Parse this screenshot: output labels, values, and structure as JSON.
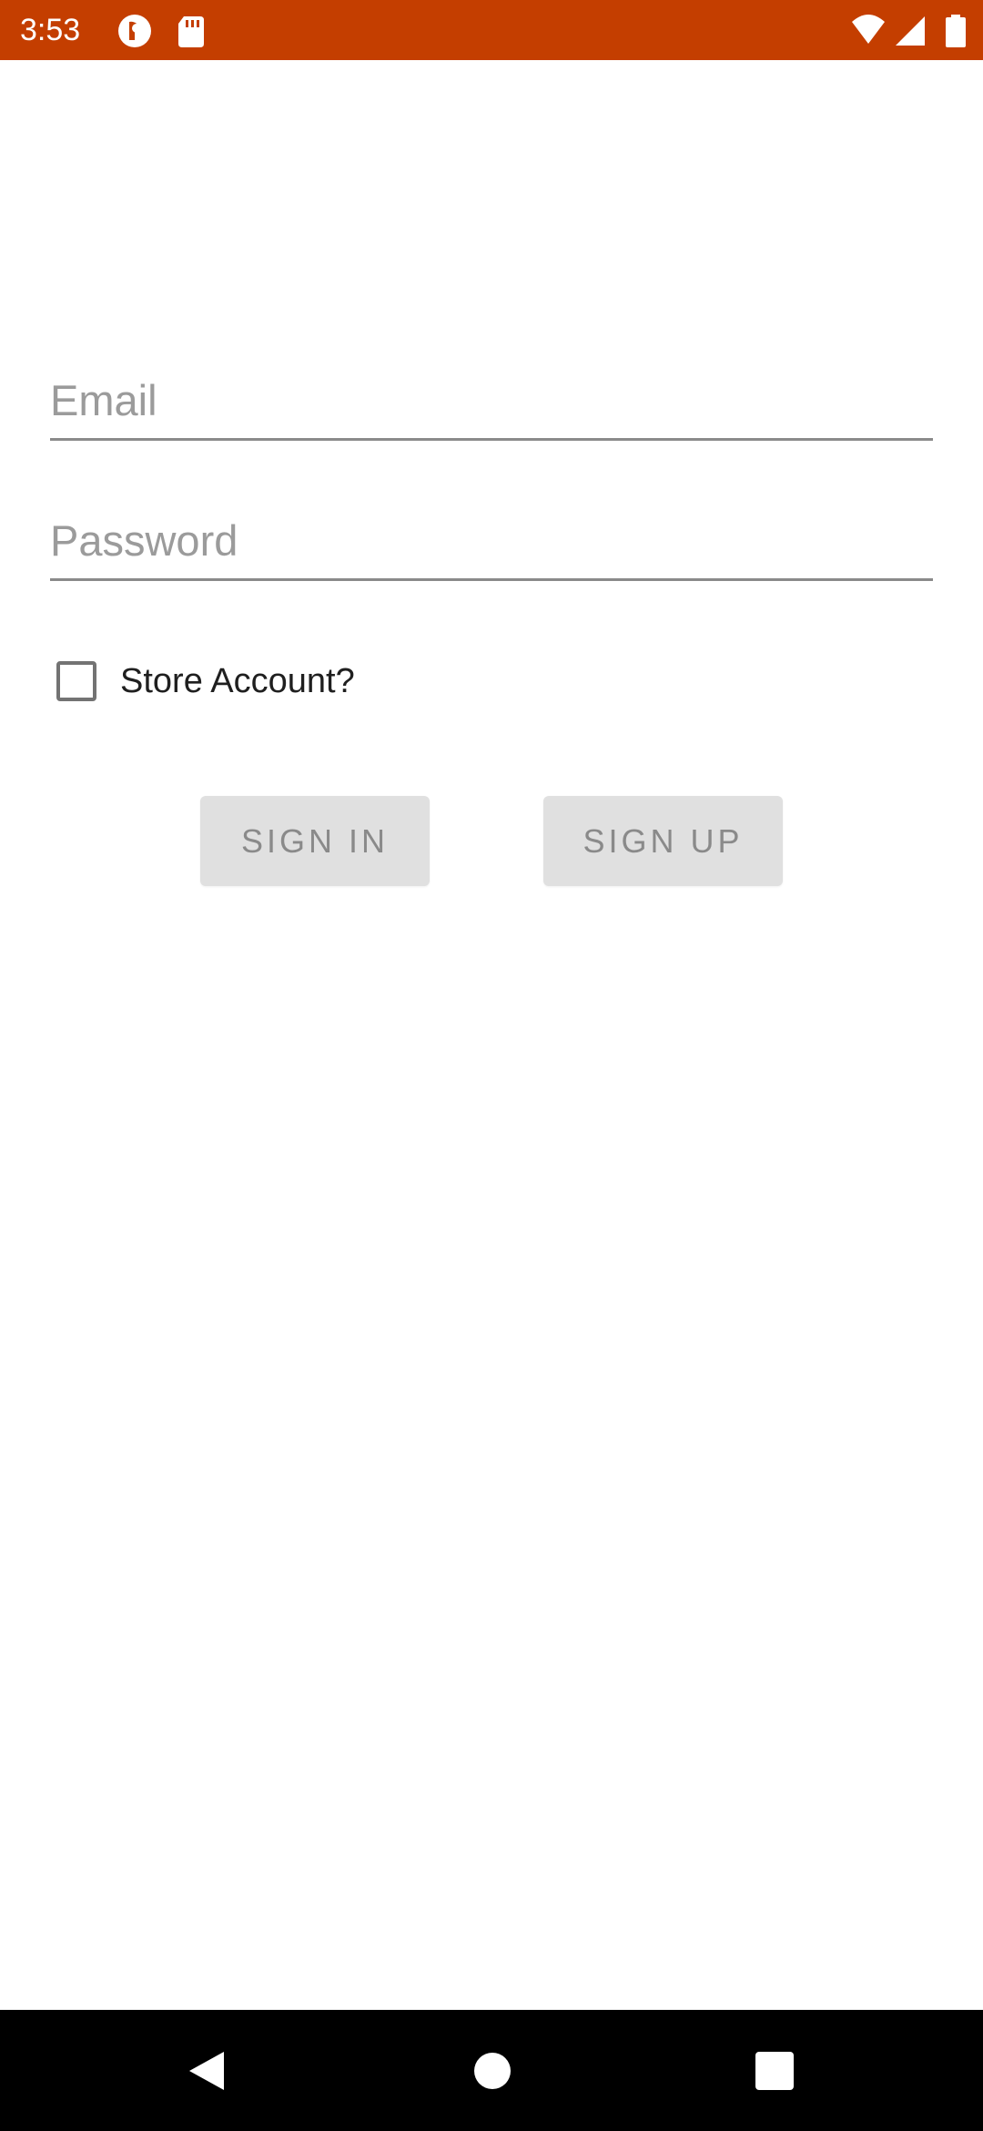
{
  "status_bar": {
    "time": "3:53",
    "left_icons": [
      "pocket-casts-icon",
      "sd-card-icon"
    ],
    "right_icons": [
      "wifi-icon",
      "signal-icon",
      "battery-icon"
    ],
    "color": "#c43e00"
  },
  "form": {
    "email": {
      "placeholder": "Email",
      "value": ""
    },
    "password": {
      "placeholder": "Password",
      "value": ""
    },
    "store_account": {
      "label": "Store Account?",
      "checked": false
    }
  },
  "buttons": {
    "sign_in": "SIGN IN",
    "sign_up": "SIGN UP"
  },
  "nav_bar": {
    "items": [
      "back-icon",
      "home-icon",
      "recents-icon"
    ]
  }
}
